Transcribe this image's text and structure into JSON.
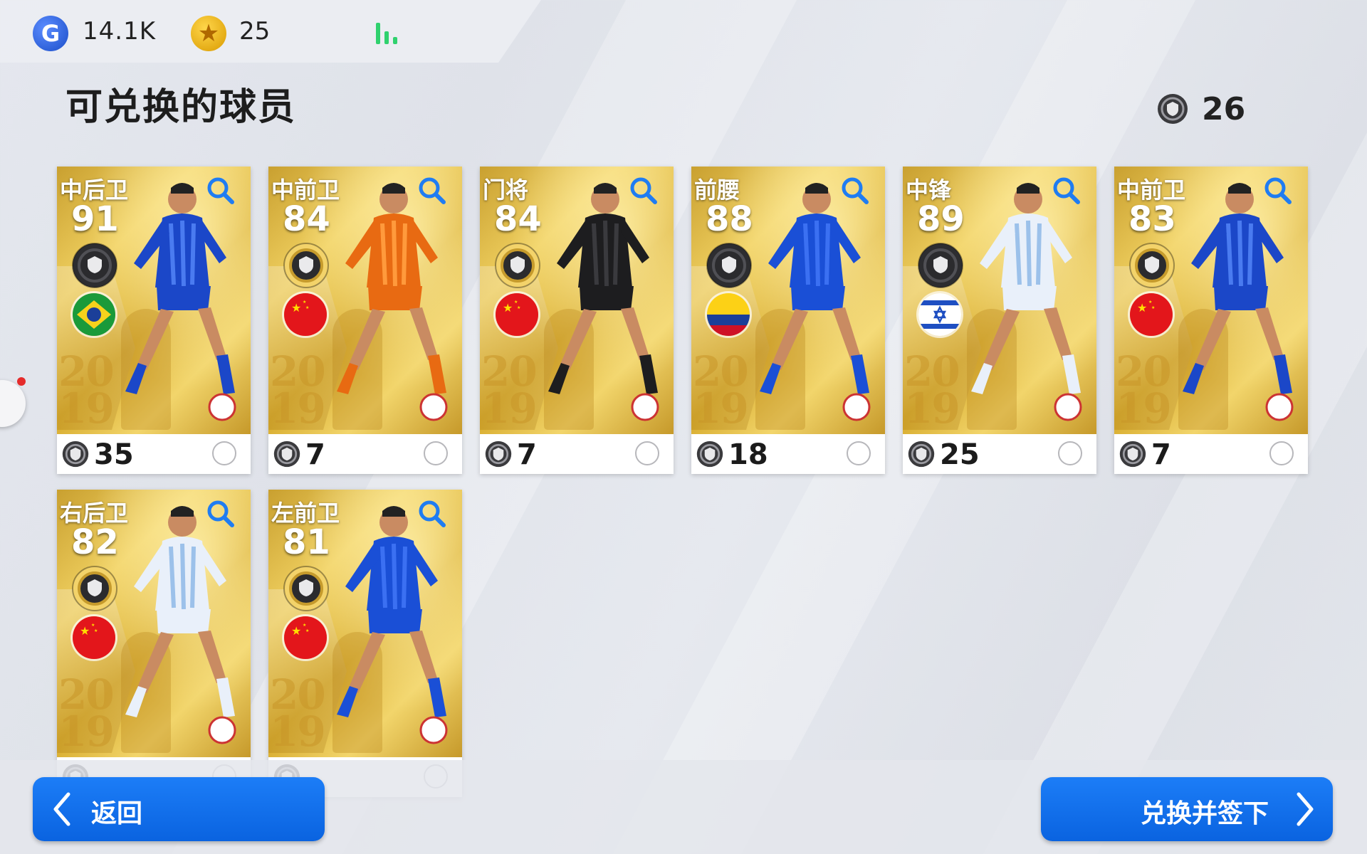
{
  "header": {
    "gp_value": "14.1K",
    "coin_value": "25",
    "title": "可兑换的球员",
    "ticket_count": "26"
  },
  "colors": {
    "accent_blue": "#0a63e0",
    "card_gold": "#e2bb45",
    "signal_green": "#2fd16e"
  },
  "cards": [
    {
      "position": "中后卫",
      "rating": "91",
      "badge": "black-badge-icon",
      "flag": "brazil-flag-icon",
      "cost": "35",
      "kit": "blue-stripe"
    },
    {
      "position": "中前卫",
      "rating": "84",
      "badge": "gold-badge-icon",
      "flag": "china-flag-icon",
      "cost": "7",
      "kit": "orange"
    },
    {
      "position": "门将",
      "rating": "84",
      "badge": "gold-badge-icon",
      "flag": "china-flag-icon",
      "cost": "7",
      "kit": "black"
    },
    {
      "position": "前腰",
      "rating": "88",
      "badge": "black-badge-icon",
      "flag": "colombia-flag-icon",
      "cost": "18",
      "kit": "blue"
    },
    {
      "position": "中锋",
      "rating": "89",
      "badge": "black-badge-icon",
      "flag": "israel-flag-icon",
      "cost": "25",
      "kit": "sky-stripe"
    },
    {
      "position": "中前卫",
      "rating": "83",
      "badge": "gold-badge-icon",
      "flag": "china-flag-icon",
      "cost": "7",
      "kit": "blue-stripe"
    },
    {
      "position": "右后卫",
      "rating": "82",
      "badge": "gold-badge-icon",
      "flag": "china-flag-icon",
      "cost": "",
      "kit": "sky-stripe"
    },
    {
      "position": "左前卫",
      "rating": "81",
      "badge": "gold-badge-icon",
      "flag": "china-flag-icon",
      "cost": "",
      "kit": "blue"
    }
  ],
  "buttons": {
    "back": "返回",
    "exchange_sign": "兑换并签下"
  }
}
